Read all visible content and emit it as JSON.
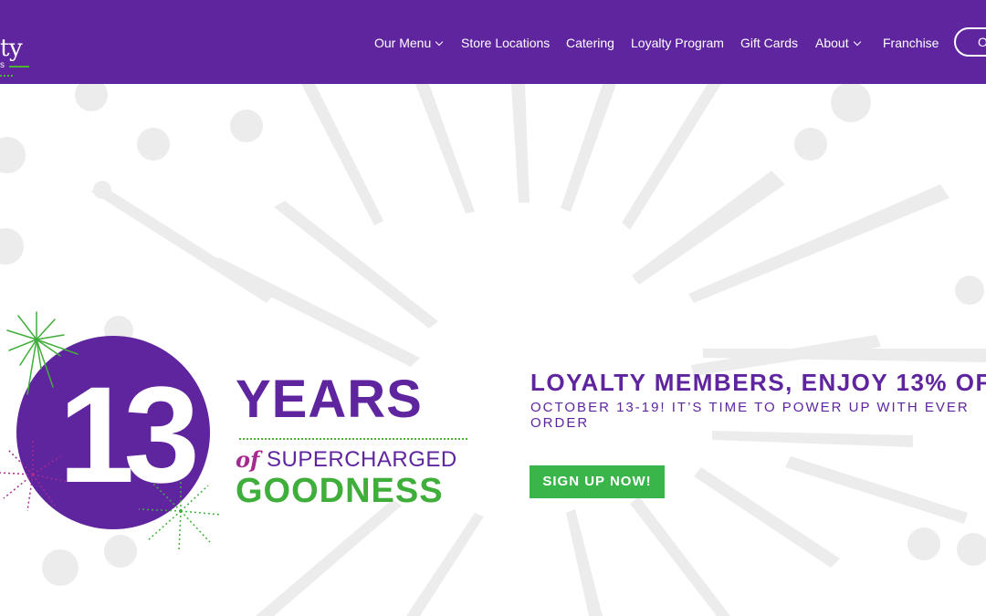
{
  "header": {
    "logo_text": "ty",
    "logo_sub": "s",
    "nav": {
      "our_menu": "Our Menu",
      "store_locations": "Store Locations",
      "catering": "Catering",
      "loyalty_program": "Loyalty Program",
      "gift_cards": "Gift Cards",
      "about": "About",
      "franchise": "Franchise"
    },
    "order_button": "O"
  },
  "hero": {
    "badge": {
      "number": "13",
      "years": "YEARS",
      "of": "of",
      "supercharged": "SUPERCHARGED",
      "goodness": "GOODNESS"
    },
    "promo_title": "LOYALTY MEMBERS, ENJOY 13% OF",
    "promo_subtitle": "OCTOBER 13-19! IT’S TIME TO POWER UP WITH EVER ORDER",
    "cta_label": "SIGN UP NOW!"
  },
  "colors": {
    "brand_purple": "#5f259f",
    "brand_green": "#39b54a",
    "accent_magenta": "#a52a8f"
  }
}
